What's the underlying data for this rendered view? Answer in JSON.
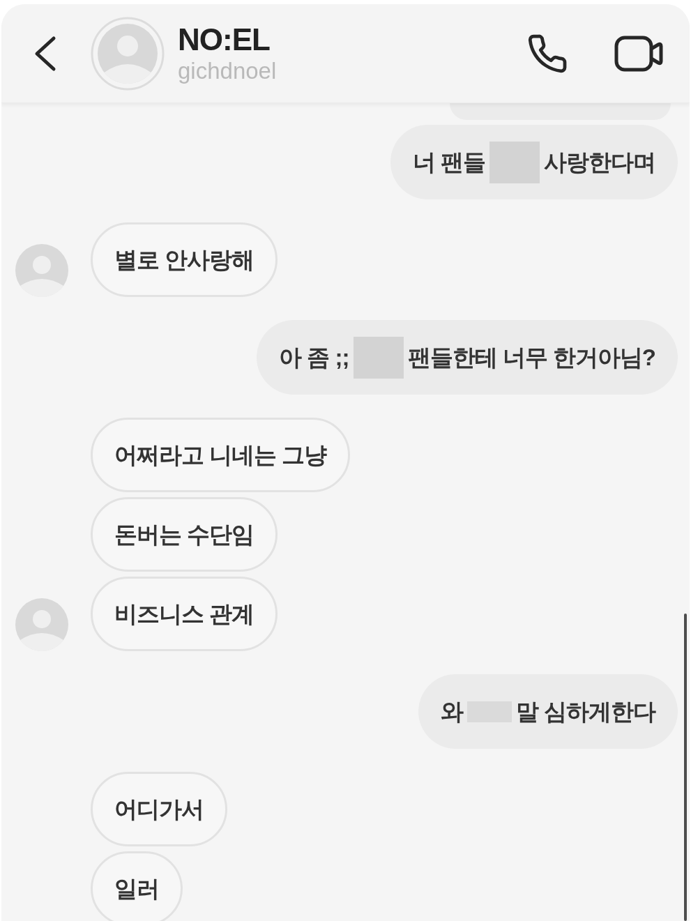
{
  "header": {
    "title": "NO:EL",
    "username": "gichdnoel"
  },
  "messages": [
    {
      "outgoing": true,
      "kind": "cut",
      "avatar": false
    },
    {
      "outgoing": true,
      "kind": "text",
      "avatar": false,
      "parts": [
        {
          "kind": "text",
          "text": "너 팬들"
        },
        {
          "kind": "block"
        },
        {
          "kind": "text",
          "text": "사랑한다며"
        }
      ]
    },
    {
      "outgoing": false,
      "kind": "text",
      "avatar": true,
      "parts": [
        {
          "kind": "text",
          "text": "별로 안사랑해"
        }
      ]
    },
    {
      "outgoing": true,
      "kind": "text",
      "avatar": false,
      "parts": [
        {
          "kind": "text",
          "text": "아 좀 ;;"
        },
        {
          "kind": "block"
        },
        {
          "kind": "text",
          "text": "팬들한테 너무 한거아님?"
        }
      ]
    },
    {
      "outgoing": false,
      "kind": "text",
      "avatar": false,
      "parts": [
        {
          "kind": "text",
          "text": "어쩌라고 니네는 그냥"
        }
      ]
    },
    {
      "outgoing": false,
      "kind": "text",
      "avatar": false,
      "parts": [
        {
          "kind": "text",
          "text": "돈버는 수단임"
        }
      ]
    },
    {
      "outgoing": false,
      "kind": "text",
      "avatar": true,
      "parts": [
        {
          "kind": "text",
          "text": "비즈니스 관계"
        }
      ]
    },
    {
      "outgoing": true,
      "kind": "text",
      "avatar": false,
      "parts": [
        {
          "kind": "text",
          "text": "와"
        },
        {
          "kind": "strip"
        },
        {
          "kind": "text",
          "text": "말 심하게한다"
        }
      ]
    },
    {
      "outgoing": false,
      "kind": "text",
      "avatar": false,
      "parts": [
        {
          "kind": "text",
          "text": "어디가서"
        }
      ]
    },
    {
      "outgoing": false,
      "kind": "text",
      "avatar": false,
      "parts": [
        {
          "kind": "text",
          "text": "일러"
        }
      ]
    }
  ]
}
